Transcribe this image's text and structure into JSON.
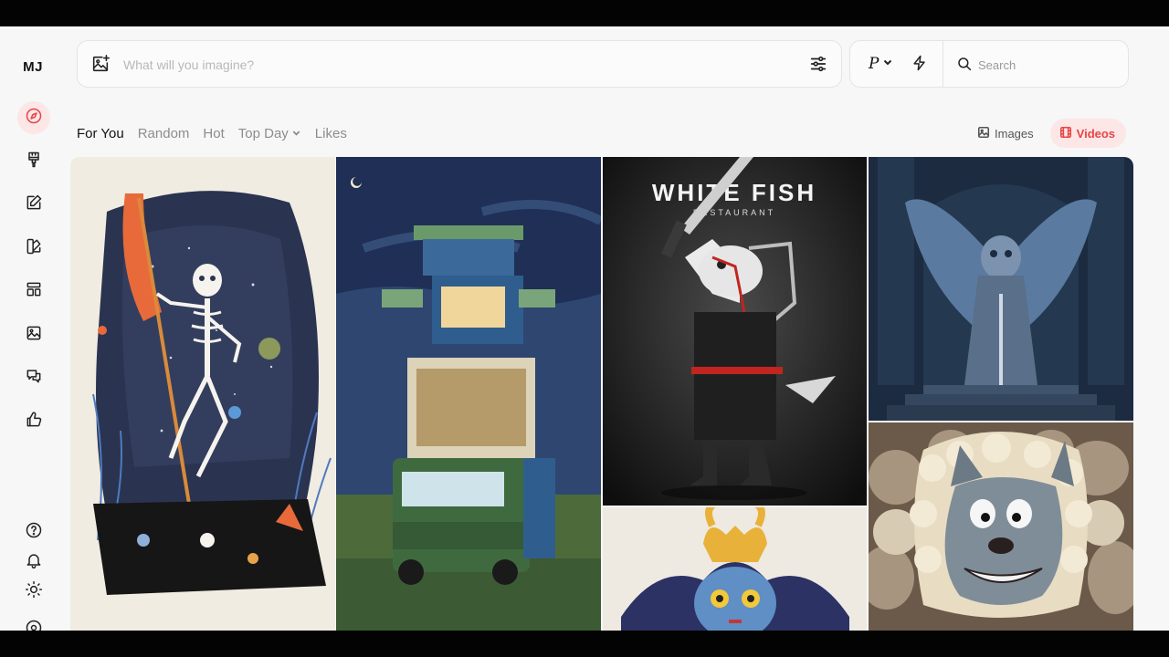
{
  "app": {
    "logo": "MJ"
  },
  "prompt": {
    "placeholder": "What will you imagine?"
  },
  "controls": {
    "mode_label": "P",
    "search_placeholder": "Search"
  },
  "tabs": [
    {
      "label": "For You",
      "active": true
    },
    {
      "label": "Random",
      "active": false
    },
    {
      "label": "Hot",
      "active": false
    },
    {
      "label": "Top Day",
      "active": false
    },
    {
      "label": "Likes",
      "active": false
    }
  ],
  "media_toggle": {
    "images_label": "Images",
    "videos_label": "Videos",
    "active": "Videos"
  },
  "sidebar": {
    "items": [
      {
        "icon": "compass-icon",
        "active": true
      },
      {
        "icon": "brush-icon"
      },
      {
        "icon": "edit-icon"
      },
      {
        "icon": "palette-icon"
      },
      {
        "icon": "layout-icon"
      },
      {
        "icon": "image-icon"
      },
      {
        "icon": "chat-icon"
      },
      {
        "icon": "thumbs-up-icon"
      }
    ],
    "bottom": [
      {
        "icon": "help-icon"
      },
      {
        "icon": "bell-icon"
      },
      {
        "icon": "sun-icon"
      }
    ]
  },
  "gallery": {
    "fish_poster_title": "WHITE FISH",
    "fish_poster_subtitle": "RESTAURANT"
  },
  "colors": {
    "accent": "#e64545",
    "accent_bg": "#fde6e6",
    "background": "#f7f7f7"
  }
}
